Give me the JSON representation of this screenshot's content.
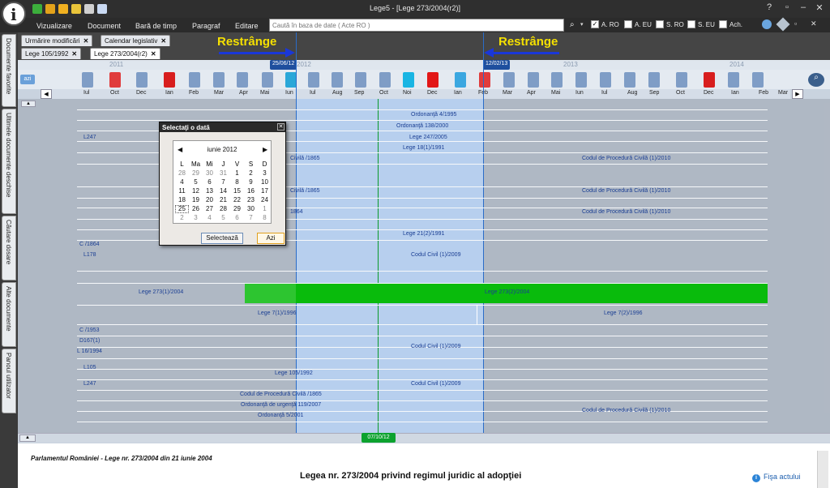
{
  "app": {
    "title": "Lege5 - [Lege 273/2004(r2)]"
  },
  "menu": [
    "Vizualizare",
    "Document",
    "Bară de timp",
    "Paragraf",
    "Editare"
  ],
  "search": {
    "placeholder": "Caută în baza de date ( Acte RO )"
  },
  "filters": [
    {
      "label": "A. RO",
      "checked": true
    },
    {
      "label": "A. EU",
      "checked": false
    },
    {
      "label": "S. RO",
      "checked": false
    },
    {
      "label": "S. EU",
      "checked": false
    },
    {
      "label": "Ach.",
      "checked": false
    }
  ],
  "sidebar": [
    "Documente favorite",
    "Ultimele documente deschise",
    "Căutare dosare",
    "Alte documente",
    "Panoul utilizator"
  ],
  "tabs_top": [
    "Urmărire modificări",
    "Calendar legislativ"
  ],
  "tabs_bottom": [
    "Lege 105/1992",
    "Lege 273/2004(r2)"
  ],
  "timeline": {
    "restrange_left": "Restrânge",
    "restrange_right": "Restrânge",
    "start_flag": "25/06/12",
    "end_flag": "12/02/13",
    "today_flag": "07/10/12",
    "azi": "azi",
    "years": [
      "2011",
      "2012",
      "2013",
      "2014"
    ],
    "months": [
      "Iul",
      "Oct",
      "Dec",
      "Ian",
      "Feb",
      "Mar",
      "Apr",
      "Mai",
      "Iun",
      "Iul",
      "Aug",
      "Sep",
      "Oct",
      "Noi",
      "Dec",
      "Ian",
      "Feb",
      "Mar",
      "Apr",
      "Mai",
      "Iun",
      "Iul",
      "Aug",
      "Sep",
      "Oct",
      "Dec",
      "Ian",
      "Feb",
      "Mar"
    ]
  },
  "rows": {
    "center": [
      "Ordonanţă 4/1995",
      "Ordonanţă 138/2000",
      "Lege 247/2005",
      "Lege 18(1)/1991",
      "Lege 21(2)/1991",
      "Codul Civil (1)/2009",
      "Codul Civil (1)/2009",
      "Codul Civil (1)/2009"
    ],
    "civila_band": [
      "Civilă /1865",
      "Civilă /1865",
      "1864"
    ],
    "right": [
      "Codul de Procedură Civilă (1)/2010",
      "Codul de Procedură Civilă (1)/2010",
      "Codul de Procedură Civilă (1)/2010",
      "Codul de Procedură Civilă (1)/2010"
    ],
    "left_small": [
      "L247",
      "C /1864",
      "L178",
      "C /1953",
      "D167(1)",
      "L 16/1994",
      "L105",
      "L247"
    ],
    "lege273_1": "Lege 273(1)/2004",
    "lege273_2": "Lege 273(2)/2004",
    "lege7_1": "Lege 7(1)/1996",
    "lege7_2": "Lege 7(2)/1996",
    "lege105": "Lege 105/1992",
    "cpc1865": "Codul de Procedură Civilă /1865",
    "ou119": "Ordonanţă de urgenţă 119/2007",
    "ord5": "Ordonanţă 5/2001"
  },
  "dialog": {
    "title": "Selectaţi o dată",
    "month": "iunie 2012",
    "weekdays": [
      "L",
      "Ma",
      "Mi",
      "J",
      "V",
      "S",
      "D"
    ],
    "weeks": [
      [
        "28",
        "29",
        "30",
        "31",
        "1",
        "2",
        "3"
      ],
      [
        "4",
        "5",
        "6",
        "7",
        "8",
        "9",
        "10"
      ],
      [
        "11",
        "12",
        "13",
        "14",
        "15",
        "16",
        "17"
      ],
      [
        "18",
        "19",
        "20",
        "21",
        "22",
        "23",
        "24"
      ],
      [
        "25",
        "26",
        "27",
        "28",
        "29",
        "30",
        "1"
      ],
      [
        "2",
        "3",
        "4",
        "5",
        "6",
        "7",
        "8"
      ]
    ],
    "select_button": "Selectează",
    "today_button": "Azi"
  },
  "document": {
    "source": "Parlamentul României - Lege nr. 273/2004 din 21 iunie 2004",
    "title": "Legea nr. 273/2004 privind regimul juridic al adopţiei",
    "fisa": "Fişa actului"
  }
}
